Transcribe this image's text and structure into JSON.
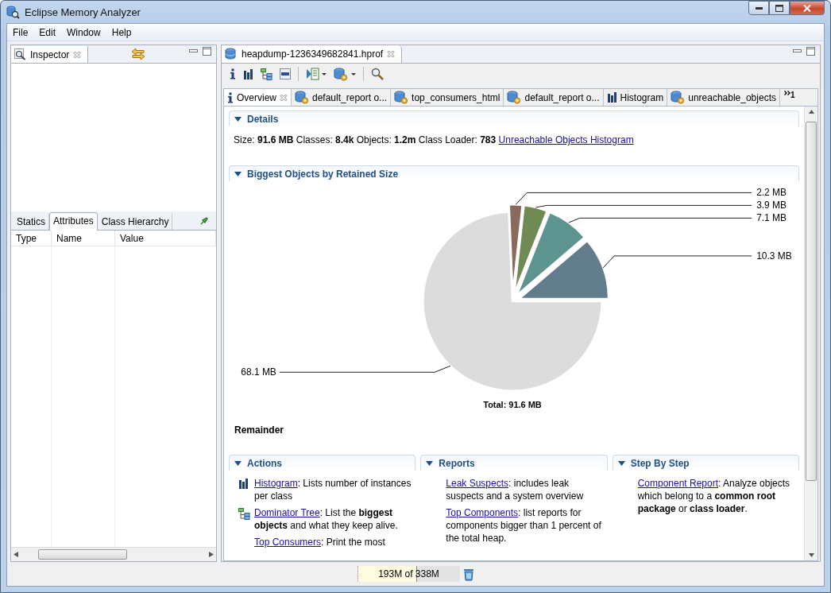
{
  "window": {
    "title": "Eclipse Memory Analyzer"
  },
  "menu": [
    "File",
    "Edit",
    "Window",
    "Help"
  ],
  "inspector": {
    "title": "Inspector",
    "tabs": [
      {
        "label": "Statics",
        "selected": false
      },
      {
        "label": "Attributes",
        "selected": true
      },
      {
        "label": "Class Hierarchy",
        "selected": false
      }
    ],
    "columns": [
      "Type",
      "Name",
      "Value"
    ]
  },
  "editor": {
    "title": "heapdump-1236349682841.hprof",
    "tabs": [
      {
        "label": "Overview",
        "kind": "info",
        "selected": true,
        "closable": true
      },
      {
        "label": "default_report  o...",
        "kind": "report",
        "selected": false,
        "closable": false
      },
      {
        "label": "top_consumers_html",
        "kind": "report",
        "selected": false,
        "closable": false
      },
      {
        "label": "default_report  o...",
        "kind": "report",
        "selected": false,
        "closable": false
      },
      {
        "label": "Histogram",
        "kind": "histogram",
        "selected": false,
        "closable": false
      },
      {
        "label": "unreachable_objects",
        "kind": "report",
        "selected": false,
        "closable": false
      }
    ],
    "more_tabs": "1"
  },
  "details": {
    "title": "Details",
    "text": "Size: **91.6 MB** Classes: **8.4k** Objects: **1.2m** Class Loader: **783**",
    "link": "Unreachable Objects Histogram"
  },
  "biggest": {
    "title": "Biggest Objects by Retained Size",
    "chart_data": {
      "type": "pie",
      "values": [
        2.2,
        3.9,
        7.1,
        10.3,
        68.1
      ],
      "colors": [
        "#8a6a5c",
        "#6f8a52",
        "#5e948f",
        "#617d8c",
        "#dcdcdc"
      ],
      "value_labels": [
        "2.2 MB",
        "3.9 MB",
        "7.1 MB",
        "10.3 MB",
        "68.1 MB"
      ],
      "annotations": [
        "Total: 91.6 MB"
      ]
    },
    "caption": "Remainder"
  },
  "panels": [
    {
      "title": "Actions",
      "items": [
        {
          "kind": "histogram",
          "link": "Histogram",
          "text": ": Lists number of instances per class"
        },
        {
          "kind": "tree",
          "link": "Dominator Tree",
          "text": ": List the **biggest objects** and what they keep alive."
        },
        {
          "kind": "plain",
          "link": "Top Consumers",
          "text": ": Print the most"
        }
      ]
    },
    {
      "title": "Reports",
      "items": [
        {
          "kind": "plain",
          "link": "Leak Suspects",
          "text": ": includes leak suspects and a system overview"
        },
        {
          "kind": "plain",
          "link": "Top Components",
          "text": ": list reports for components bigger than 1 percent of the total heap."
        }
      ]
    },
    {
      "title": "Step By Step",
      "items": [
        {
          "kind": "plain",
          "link": "Component Report",
          "text": ": Analyze objects which belong to a **common root package** or **class loader**."
        }
      ]
    }
  ],
  "heap_status": {
    "text": "193M of 338M",
    "level": 0.571
  }
}
